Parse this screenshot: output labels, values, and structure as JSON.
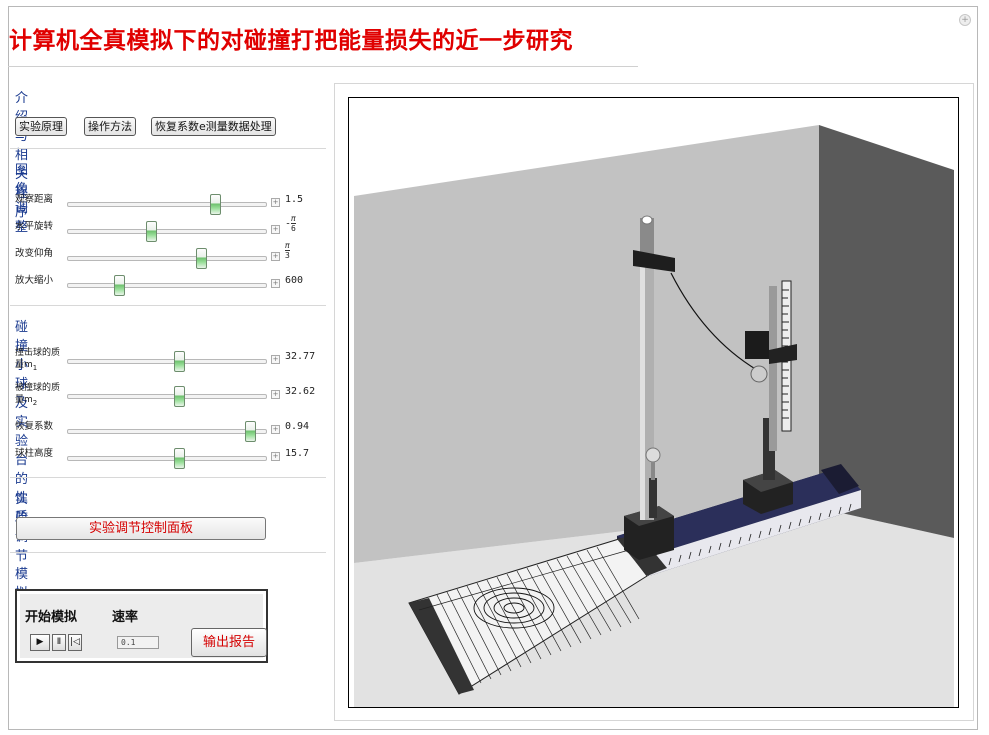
{
  "title": "计算机全真模拟下的对碰撞打把能量损失的近一步研究",
  "corner_button": "+",
  "sections": {
    "intro": {
      "heading": "介绍与相关程序",
      "buttons": [
        "实验原理",
        "操作方法",
        "恢复系数e测量数据处理"
      ]
    },
    "image": {
      "heading": "图像调整",
      "sliders": [
        {
          "label": "观察距离",
          "value": "1.5",
          "fraction": 0.74
        },
        {
          "label": "水平旋转",
          "value_prefix": "-",
          "frac_num": "π",
          "frac_den": "6",
          "fraction": 0.42
        },
        {
          "label": "改变仰角",
          "value_prefix": "",
          "frac_num": "π",
          "frac_den": "3",
          "fraction": 0.67
        },
        {
          "label": "放大缩小",
          "value": "600",
          "fraction": 0.26
        }
      ]
    },
    "props": {
      "heading": "碰撞小球及实验台的性质",
      "sliders": [
        {
          "label": "撞击球的质量m",
          "label_sub": "1",
          "value": "32.77",
          "fraction": 0.56
        },
        {
          "label": "被撞球的质量m",
          "label_sub": "2",
          "value": "32.62",
          "fraction": 0.56
        },
        {
          "label": "恢复系数",
          "value": "0.94",
          "fraction": 0.92
        },
        {
          "label": "球柱高度",
          "value": "15.7",
          "fraction": 0.56
        }
      ]
    },
    "adjust": {
      "heading": "实验调节",
      "panel_button": "实验调节控制面板"
    },
    "simulate": {
      "heading": "模拟",
      "start_label": "开始模拟",
      "rate_label": "速率",
      "rate_value": "0.1",
      "play_icon": "play-icon",
      "pause_icon": "pause-icon",
      "reset_icon": "step-back-icon",
      "report_button": "输出报告"
    }
  },
  "colors": {
    "title": "#e00000",
    "heading": "#1a3a8f",
    "button_text_red": "#d40000",
    "wall_right": "#555555",
    "wall_back": "#bdbdbd",
    "floor": "#d8d8d8",
    "base_dark": "#1d1f3a"
  }
}
